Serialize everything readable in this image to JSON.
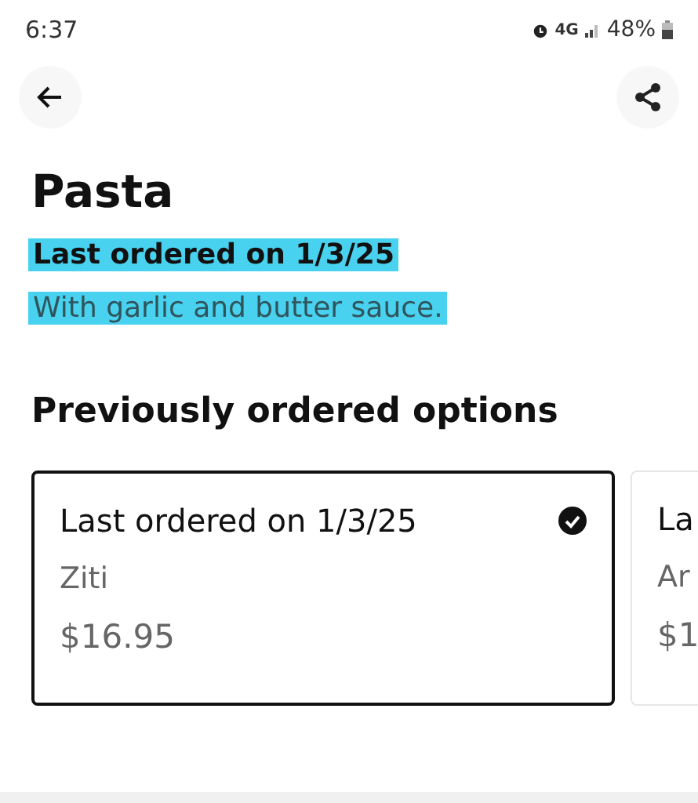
{
  "status_bar": {
    "time": "6:37",
    "network": "4G",
    "battery": "48%"
  },
  "item": {
    "title": "Pasta",
    "last_ordered": "Last ordered on 1/3/25",
    "last_ordered_highlighted": true,
    "description": "With garlic and butter sauce.",
    "description_highlighted": true
  },
  "section": {
    "heading": "Previously ordered options"
  },
  "options": [
    {
      "title": "Last ordered on 1/3/25",
      "name": "Ziti",
      "price": "$16.95",
      "selected": true
    },
    {
      "title": "La",
      "name": "Ar",
      "price": "$1",
      "selected": false
    }
  ]
}
